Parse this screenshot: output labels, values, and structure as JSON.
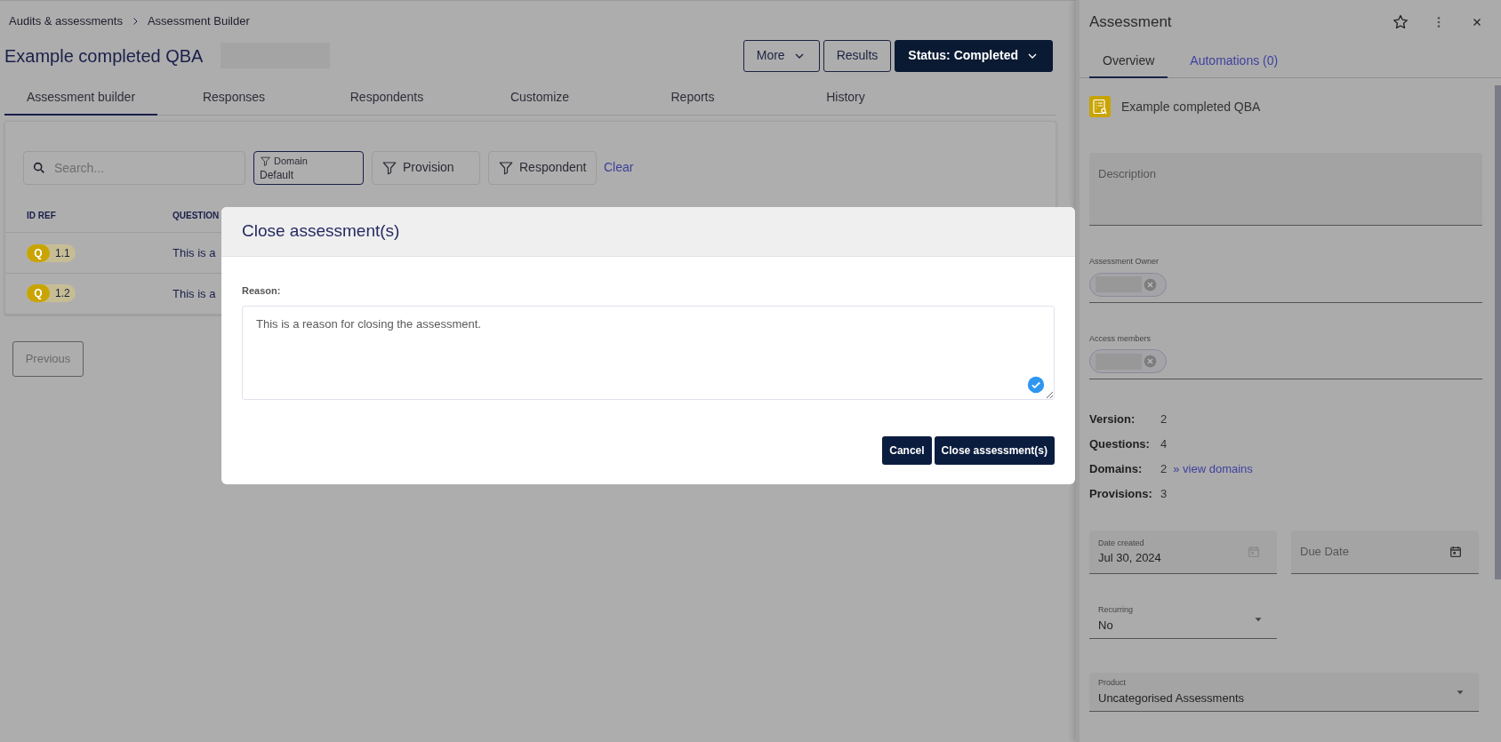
{
  "breadcrumb": [
    {
      "label": "Audits & assessments"
    },
    {
      "label": "Assessment Builder"
    }
  ],
  "page_title": "Example completed QBA",
  "header_buttons": [
    {
      "label": "More",
      "kind": "dropdown"
    },
    {
      "label": "Results",
      "kind": "outline"
    },
    {
      "label": "Status: Completed",
      "kind": "primary"
    }
  ],
  "tabs": [
    {
      "label": "Assessment builder",
      "selected": true
    },
    {
      "label": "Responses",
      "selected": false
    },
    {
      "label": "Respondents",
      "selected": false
    },
    {
      "label": "Customize",
      "selected": false
    },
    {
      "label": "Reports",
      "selected": false
    },
    {
      "label": "History",
      "selected": false
    }
  ],
  "filters": {
    "search": {
      "placeholder": "Search..."
    },
    "chips": [
      {
        "label": "Domain",
        "value": "Default",
        "selected": true
      },
      {
        "label": "Provision",
        "selected": false
      },
      {
        "label": "Respondent",
        "selected": false
      }
    ],
    "clear": "Clear"
  },
  "table": {
    "columns": [
      "ID REF",
      "QUESTION"
    ],
    "rows": [
      {
        "type": "Q",
        "ref": "1.1",
        "question": "This is a"
      },
      {
        "type": "Q",
        "ref": "1.2",
        "question": "This is a"
      }
    ]
  },
  "pagination": {
    "previous": "Previous"
  },
  "modal": {
    "title": "Close assessment(s)",
    "reason_label": "Reason:",
    "reason_value": "This is a reason for closing the assessment.",
    "valid": true,
    "buttons": [
      "Cancel",
      "Close assessment(s)"
    ]
  },
  "panel": {
    "title": "Assessment",
    "tabs": [
      {
        "label": "Overview",
        "selected": true
      },
      {
        "label": "Automations (0)",
        "selected": false
      }
    ],
    "item_name": "Example completed QBA",
    "description": {
      "placeholder": "Description"
    },
    "owner": {
      "label": "Assessment Owner"
    },
    "members": {
      "label": "Access members"
    },
    "stats": [
      {
        "label": "Version:",
        "value": "2"
      },
      {
        "label": "Questions:",
        "value": "4"
      },
      {
        "label": "Domains:",
        "value": "2",
        "link": "» view domains"
      },
      {
        "label": "Provisions:",
        "value": "3"
      }
    ],
    "date_created": {
      "label": "Date created",
      "value": "Jul 30, 2024"
    },
    "due_date": {
      "placeholder": "Due Date"
    },
    "recurring": {
      "label": "Recurring",
      "value": "No"
    },
    "product": {
      "label": "Product",
      "value": "Uncategorised Assessments"
    }
  }
}
